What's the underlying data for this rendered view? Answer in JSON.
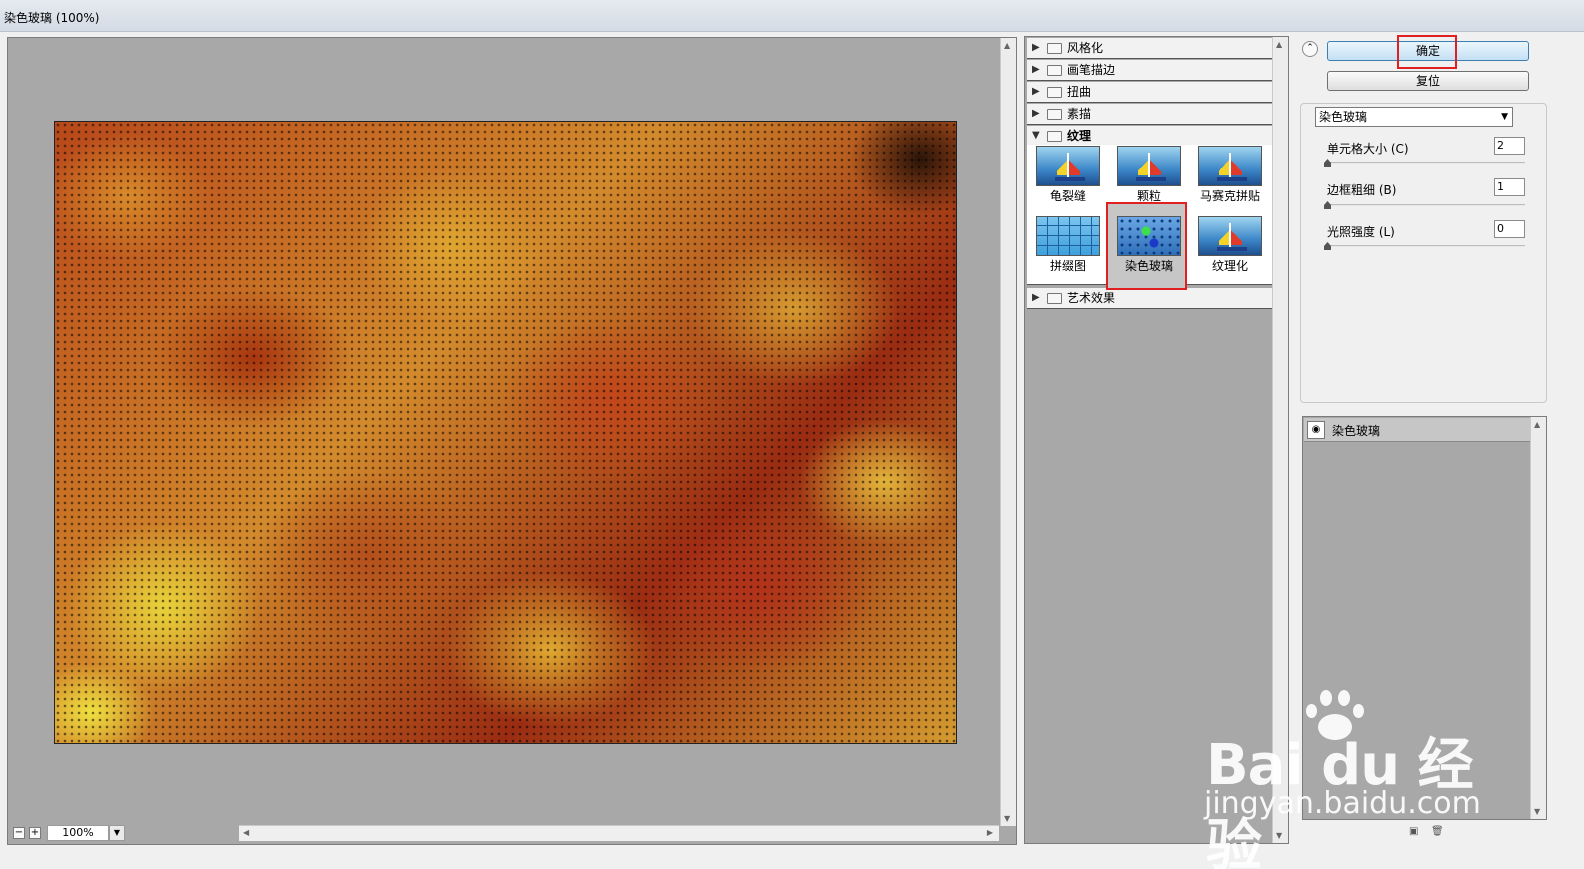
{
  "window": {
    "title": "染色玻璃 (100%)"
  },
  "preview": {
    "zoom": "100%"
  },
  "categories": [
    {
      "label": "风格化",
      "open": false
    },
    {
      "label": "画笔描边",
      "open": false
    },
    {
      "label": "扭曲",
      "open": false
    },
    {
      "label": "素描",
      "open": false
    },
    {
      "label": "纹理",
      "open": true
    },
    {
      "label": "艺术效果",
      "open": false
    }
  ],
  "texture_filters": [
    {
      "label": "龟裂缝",
      "icon": "sailboat-thumbnail"
    },
    {
      "label": "颗粒",
      "icon": "sailboat-thumbnail"
    },
    {
      "label": "马赛克拼贴",
      "icon": "sailboat-thumbnail"
    },
    {
      "label": "拼缀图",
      "icon": "tiles-thumbnail"
    },
    {
      "label": "染色玻璃",
      "icon": "stained-glass-thumbnail",
      "selected": true
    },
    {
      "label": "纹理化",
      "icon": "sailboat-thumbnail"
    }
  ],
  "buttons": {
    "ok": "确定",
    "reset": "复位"
  },
  "filter_select": {
    "value": "染色玻璃"
  },
  "params": [
    {
      "label": "单元格大小 (C)",
      "value": "2"
    },
    {
      "label": "边框粗细 (B)",
      "value": "1"
    },
    {
      "label": "光照强度 (L)",
      "value": "0"
    }
  ],
  "layers": [
    {
      "name": "染色玻璃"
    }
  ],
  "watermark": {
    "brand": "Bai du 经验",
    "url": "jingyan.baidu.com"
  },
  "colors": {
    "highlight": "#e02020",
    "panel_gray": "#a8a8a8"
  }
}
